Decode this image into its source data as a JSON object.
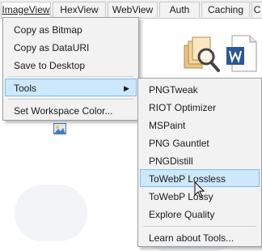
{
  "tabs": [
    {
      "label": "ImageView",
      "active": true
    },
    {
      "label": "HexView",
      "active": false
    },
    {
      "label": "WebView",
      "active": false
    },
    {
      "label": "Auth",
      "active": false
    },
    {
      "label": "Caching",
      "active": false
    },
    {
      "label": "C",
      "active": false
    }
  ],
  "context_menu": {
    "items": [
      {
        "label": "Copy as Bitmap"
      },
      {
        "label": "Copy as DataURI"
      },
      {
        "label": "Save to Desktop"
      },
      {
        "label": "Tools",
        "has_submenu": true,
        "highlighted": true
      },
      {
        "label": "Set Workspace Color..."
      }
    ]
  },
  "tools_submenu": {
    "items": [
      {
        "label": "PNGTweak"
      },
      {
        "label": "RIOT Optimizer"
      },
      {
        "label": "MSPaint"
      },
      {
        "label": "PNG Gauntlet"
      },
      {
        "label": "PNGDistill"
      },
      {
        "label": "ToWebP Lossless",
        "highlighted": true
      },
      {
        "label": "ToWebP Lossy"
      },
      {
        "label": "Explore Quality"
      },
      {
        "label": "Learn about Tools..."
      }
    ]
  },
  "colors": {
    "highlight": "#cde8fb",
    "highlight_border": "#7fbfe8",
    "menu_bg": "#f2f2f2"
  },
  "icons": [
    "magnifier-on-images-icon",
    "word-document-icon",
    "image-thumbnail-icon",
    "submenu-arrow-icon",
    "mouse-cursor-icon"
  ]
}
